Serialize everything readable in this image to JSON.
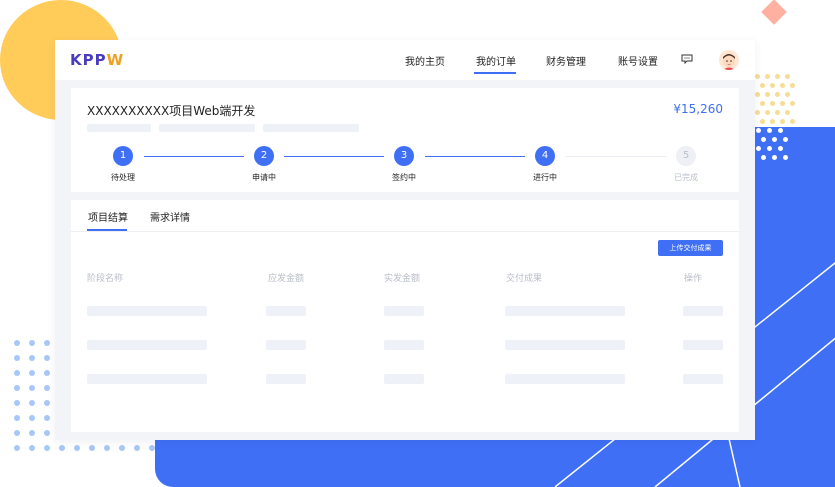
{
  "brand": {
    "logo_main": "KPP",
    "logo_accent": "W"
  },
  "nav": {
    "items": [
      {
        "label": "我的主页"
      },
      {
        "label": "我的订单"
      },
      {
        "label": "财务管理"
      },
      {
        "label": "账号设置"
      }
    ],
    "active_index": 1,
    "icons": [
      "message-icon",
      "avatar"
    ]
  },
  "project": {
    "title": "XXXXXXXXXX项目Web端开发",
    "price": "¥15,260"
  },
  "steps": [
    {
      "number": "1",
      "label": "待处理",
      "done": true
    },
    {
      "number": "2",
      "label": "申请中",
      "done": true
    },
    {
      "number": "3",
      "label": "签约中",
      "done": true
    },
    {
      "number": "4",
      "label": "进行中",
      "done": true
    },
    {
      "number": "5",
      "label": "已完成",
      "done": false
    }
  ],
  "tabs": [
    {
      "label": "项目结算",
      "active": true
    },
    {
      "label": "需求详情",
      "active": false
    }
  ],
  "upload_button": "上传交付成果",
  "table": {
    "columns": [
      "阶段名称",
      "应发金额",
      "实发金额",
      "交付成果",
      "操作"
    ]
  },
  "colors": {
    "accent": "#3f6ff5",
    "brand": "#4a3cbf",
    "brand_accent": "#f0a020",
    "yellow": "#ffcc5a"
  }
}
